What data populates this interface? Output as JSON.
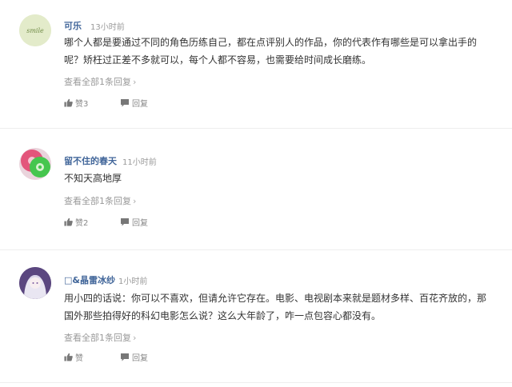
{
  "comments": [
    {
      "username": "可乐",
      "time": "13小时前",
      "content": "哪个人都是要通过不同的角色历练自己，都在点评别人的作品，你的代表作有哪些是可以拿出手的呢？矫枉过正差不多就可以，每个人都不容易，也需要给时间成长磨练。",
      "view_replies": "查看全部1条回复",
      "like_label": "赞3",
      "reply_label": "回复",
      "avatar_icon": "avatar-green-circle",
      "avatar_text": "smile"
    },
    {
      "username": "留不住的春天",
      "time": "11小时前",
      "content": "不知天高地厚",
      "view_replies": "查看全部1条回复",
      "like_label": "赞2",
      "reply_label": "回复",
      "avatar_icon": "avatar-donut"
    },
    {
      "username": "□&晶雷冰纱",
      "time": "1小时前",
      "content": "用小四的话说：你可以不喜欢，但请允许它存在。电影、电视剧本来就是题材多样、百花齐放的，那国外那些拍得好的科幻电影怎么说？这么大年龄了，咋一点包容心都没有。",
      "view_replies": "查看全部1条回复",
      "like_label": "赞",
      "reply_label": "回复",
      "avatar_icon": "avatar-anime-girl"
    }
  ],
  "colors": {
    "username": "#406599",
    "meta": "#999999",
    "divider": "#eeeeee"
  }
}
